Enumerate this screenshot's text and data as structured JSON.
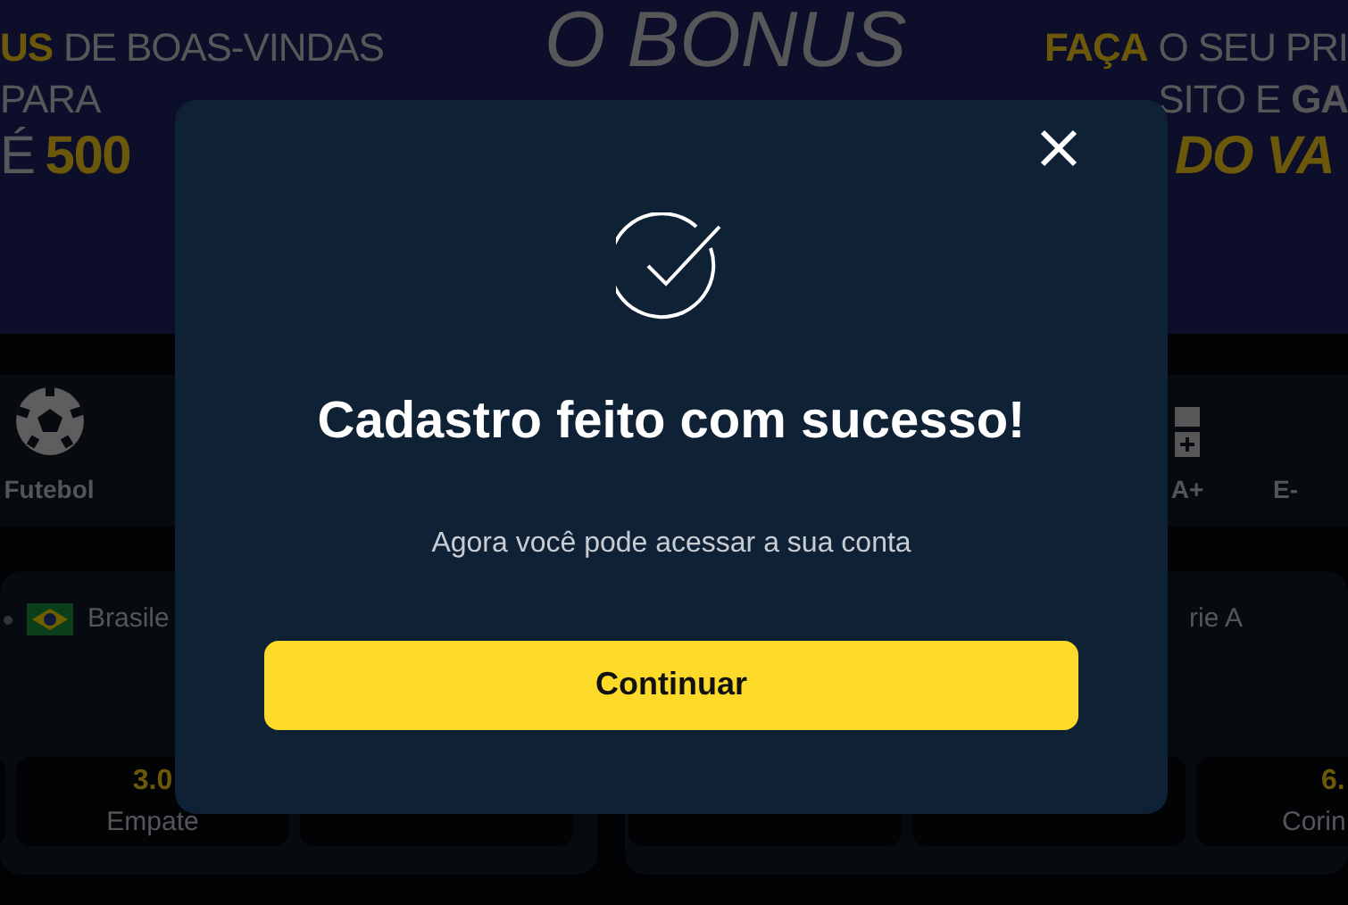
{
  "banner": {
    "left_lines": [
      [
        {
          "text": "US",
          "kind": "highlight"
        },
        {
          "text": "DE BOAS-VINDAS",
          "kind": "plain"
        }
      ],
      [
        {
          "text": "PARA",
          "kind": "plain"
        }
      ],
      [
        {
          "text": "É",
          "kind": "plain"
        },
        {
          "text": "500",
          "kind": "highlight"
        }
      ]
    ],
    "center_title": "O BONUS",
    "right_lines": [
      [
        {
          "text": "FAÇA",
          "kind": "highlight"
        },
        {
          "text": "O SEU PRI",
          "kind": "plain"
        }
      ],
      [
        {
          "text": "SITO E",
          "kind": "plain"
        },
        {
          "text": "GA",
          "kind": "strong"
        }
      ],
      [
        {
          "text": "DO VA",
          "kind": "slanted"
        }
      ]
    ]
  },
  "sports": [
    {
      "label": "Futebol",
      "kind": "ball"
    },
    {
      "label": "A+",
      "kind": "plus"
    },
    {
      "label": "E-",
      "kind": "plain"
    }
  ],
  "matches": [
    {
      "league": "Brasile",
      "odds": [
        {
          "value": "3.0",
          "label": "Empate"
        }
      ]
    },
    {
      "league": "rie A",
      "odds": [
        {
          "value": "6.",
          "label": "Corin"
        }
      ]
    }
  ],
  "dialog": {
    "title": "Cadastro feito com sucesso!",
    "message": "Agora você pode acessar a sua conta",
    "button": "Continuar"
  }
}
